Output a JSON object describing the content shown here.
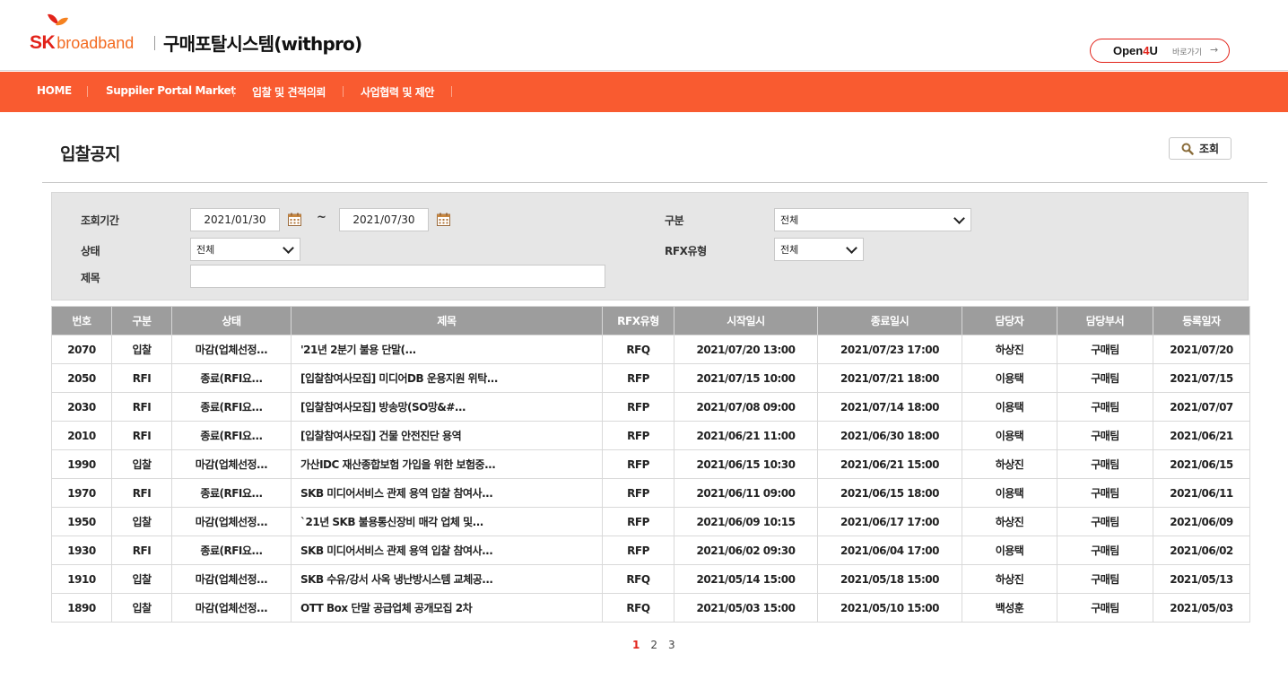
{
  "header": {
    "logo_sk": "SK",
    "logo_broadband": "broadband",
    "system_title": "구매포탈시스템(withpro)",
    "open4u_prefix": "Open",
    "open4u_four": "4",
    "open4u_suffix": "U",
    "open4u_go": "바로가기",
    "open4u_arrow": "→",
    "brand_red": "#e2231a",
    "brand_orange": "#f36b21"
  },
  "nav": {
    "bg_color": "#f95b30",
    "items": [
      "HOME",
      "Suppiler Portal Market",
      "입찰 및 견적의뢰",
      "사업협력 및 제안"
    ]
  },
  "page": {
    "title": "입찰공지",
    "search_button": "조회"
  },
  "filter": {
    "period_label": "조회기간",
    "date_from": "2021/01/30",
    "date_to": "2021/07/30",
    "tilde": "~",
    "category_label": "구분",
    "category_value": "전체",
    "status_label": "상태",
    "status_value": "전체",
    "rfx_label": "RFX유형",
    "rfx_value": "전체",
    "subject_label": "제목",
    "subject_value": ""
  },
  "table": {
    "headers": [
      "번호",
      "구분",
      "상태",
      "제목",
      "RFX유형",
      "시작일시",
      "종료일시",
      "담당자",
      "담당부서",
      "등록일자"
    ],
    "rows": [
      [
        "2070",
        "입찰",
        "마감(업체선정...",
        "'21년 2분기 불용 단말(...",
        "RFQ",
        "2021/07/20 13:00",
        "2021/07/23 17:00",
        "하상진",
        "구매팀",
        "2021/07/20"
      ],
      [
        "2050",
        "RFI",
        "종료(RFI요...",
        "[입찰참여사모집] 미디어DB 운용지원 위탁...",
        "RFP",
        "2021/07/15 10:00",
        "2021/07/21 18:00",
        "이용택",
        "구매팀",
        "2021/07/15"
      ],
      [
        "2030",
        "RFI",
        "종료(RFI요...",
        "[입찰참여사모집] 방송망(SO망&#...",
        "RFP",
        "2021/07/08 09:00",
        "2021/07/14 18:00",
        "이용택",
        "구매팀",
        "2021/07/07"
      ],
      [
        "2010",
        "RFI",
        "종료(RFI요...",
        "[입찰참여사모집] 건물 안전진단 용역",
        "RFP",
        "2021/06/21 11:00",
        "2021/06/30 18:00",
        "이용택",
        "구매팀",
        "2021/06/21"
      ],
      [
        "1990",
        "입찰",
        "마감(업체선정...",
        "가산IDC 재산종합보험 가입을 위한 보험중...",
        "RFP",
        "2021/06/15 10:30",
        "2021/06/21 15:00",
        "하상진",
        "구매팀",
        "2021/06/15"
      ],
      [
        "1970",
        "RFI",
        "종료(RFI요...",
        "SKB 미디어서비스 관제 용역 입찰 참여사...",
        "RFP",
        "2021/06/11 09:00",
        "2021/06/15 18:00",
        "이용택",
        "구매팀",
        "2021/06/11"
      ],
      [
        "1950",
        "입찰",
        "마감(업체선정...",
        "`21년 SKB 불용통신장비 매각 업체 및...",
        "RFP",
        "2021/06/09 10:15",
        "2021/06/17 17:00",
        "하상진",
        "구매팀",
        "2021/06/09"
      ],
      [
        "1930",
        "RFI",
        "종료(RFI요...",
        "SKB 미디어서비스 관제 용역 입찰 참여사...",
        "RFP",
        "2021/06/02 09:30",
        "2021/06/04 17:00",
        "이용택",
        "구매팀",
        "2021/06/02"
      ],
      [
        "1910",
        "입찰",
        "마감(업체선정...",
        "SKB 수유/강서 사옥 냉난방시스템 교체공...",
        "RFQ",
        "2021/05/14 15:00",
        "2021/05/18 15:00",
        "하상진",
        "구매팀",
        "2021/05/13"
      ],
      [
        "1890",
        "입찰",
        "마감(업체선정...",
        "OTT Box 단말 공급업체 공개모집 2차",
        "RFQ",
        "2021/05/03 15:00",
        "2021/05/10 15:00",
        "백성훈",
        "구매팀",
        "2021/05/03"
      ]
    ]
  },
  "pagination": {
    "pages": [
      "1",
      "2",
      "3"
    ],
    "current": "1"
  }
}
